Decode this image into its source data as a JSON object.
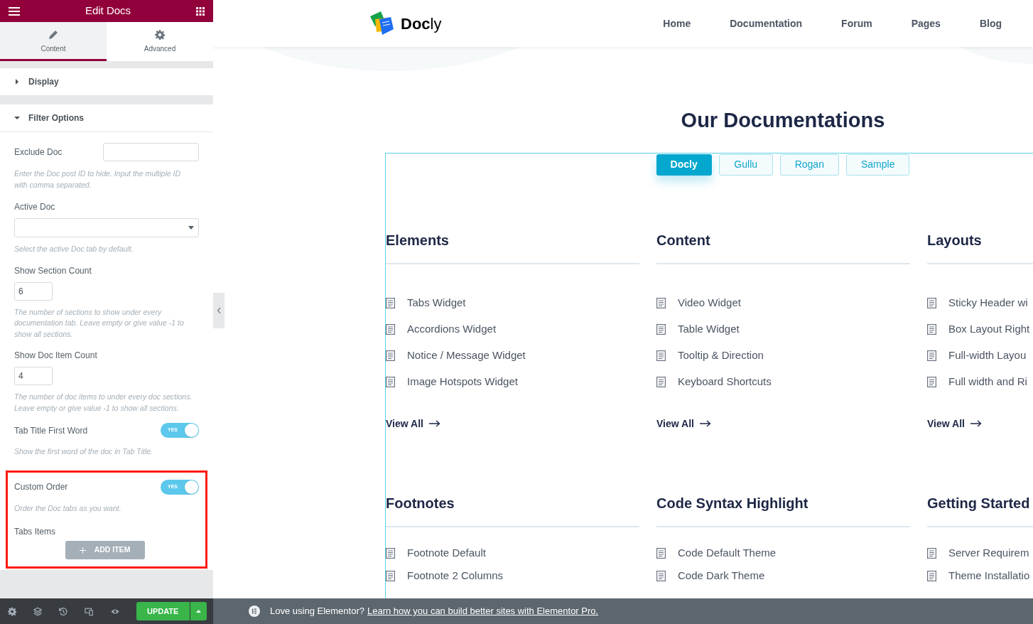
{
  "panel": {
    "title": "Edit Docs",
    "tabs": [
      {
        "label": "Content",
        "selected": true,
        "kind": "pencil"
      },
      {
        "label": "Advanced",
        "selected": false,
        "kind": "gear"
      }
    ],
    "sections": [
      {
        "title": "Display",
        "expanded": false
      },
      {
        "title": "Filter Options",
        "expanded": true
      }
    ],
    "controls": [
      {
        "kind": "text",
        "label": "Exclude Doc",
        "description": "Enter the Doc post ID to hide. Input the multiple ID with comma separated.",
        "highlighted": false
      },
      {
        "kind": "select",
        "label": "Active Doc",
        "description": "Select the active Doc tab by default.",
        "highlighted": false
      },
      {
        "kind": "number",
        "label": "Show Section Count",
        "value": "6",
        "description": "The number of sections to show under every documentation tab. Leave empty or give value -1 to show all sections.",
        "highlighted": false
      },
      {
        "kind": "number",
        "label": "Show Doc Item Count",
        "value": "4",
        "description": "The number of doc items to under every doc sections. Leave empty or give value -1 to show all sections.",
        "highlighted": false
      },
      {
        "kind": "switch",
        "label": "Tab Title First Word",
        "on": true,
        "on_label": "YES",
        "description": "Show the first word of the doc in Tab Title.",
        "highlighted": false
      },
      {
        "kind": "switch",
        "label": "Custom Order",
        "on": true,
        "on_label": "YES",
        "description": "Order the Doc tabs as you want.",
        "highlighted": true
      },
      {
        "kind": "repeater",
        "label": "Tabs Items",
        "button": "ADD ITEM",
        "highlighted": true
      }
    ],
    "update_button": "UPDATE"
  },
  "site": {
    "logo": "**Doc**ly",
    "nav": [
      "Home",
      "Documentation",
      "Forum",
      "Pages",
      "Blog"
    ],
    "heading": "Our Documentations",
    "doc_tabs": [
      {
        "label": "Docly",
        "selected": true
      },
      {
        "label": "Gullu",
        "selected": false
      },
      {
        "label": "Rogan",
        "selected": false
      },
      {
        "label": "Sample",
        "selected": false
      }
    ],
    "sections": [
      {
        "title": "Elements",
        "items": [
          "Tabs Widget",
          "Accordions Widget",
          "Notice / Message Widget",
          "Image Hotspots Widget"
        ],
        "view_all": "View All"
      },
      {
        "title": "Content",
        "items": [
          "Video Widget",
          "Table Widget",
          "Tooltip & Direction",
          "Keyboard Shortcuts"
        ],
        "view_all": "View All"
      },
      {
        "title": "Layouts",
        "items": [
          "Sticky Header wi",
          "Box Layout Right",
          "Full-width Layou",
          "Full width and Ri"
        ],
        "view_all": "View All"
      },
      {
        "title": "Footnotes",
        "items": [
          "Footnote Default",
          "Footnote 2 Columns"
        ]
      },
      {
        "title": "Code Syntax Highlight",
        "items": [
          "Code Default Theme",
          "Code Dark Theme"
        ]
      },
      {
        "title": "Getting Started",
        "items": [
          "Server Requirem",
          "Theme Installatio"
        ]
      }
    ]
  },
  "notice": {
    "text": "Love using Elementor?",
    "link": "Learn how you can build better sites with Elementor Pro."
  }
}
